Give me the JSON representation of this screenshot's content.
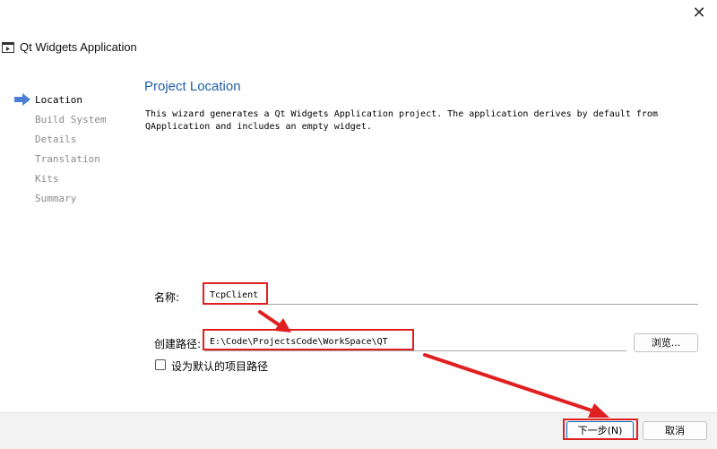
{
  "window": {
    "title": "Qt Widgets Application",
    "close_glyph": "✕"
  },
  "sidebar": {
    "items": [
      {
        "label": "Location",
        "active": true
      },
      {
        "label": "Build System",
        "active": false
      },
      {
        "label": "Details",
        "active": false
      },
      {
        "label": "Translation",
        "active": false
      },
      {
        "label": "Kits",
        "active": false
      },
      {
        "label": "Summary",
        "active": false
      }
    ],
    "active_indicator_icon": "arrow-right-icon",
    "active_indicator_color": "#4a7fd4"
  },
  "main": {
    "title": "Project Location",
    "description_line1": "This wizard generates a Qt Widgets Application project. The application derives by default from",
    "description_line2": "QApplication and includes an empty widget.",
    "name_label": "名称:",
    "name_value": "TcpClient",
    "path_label": "创建路径:",
    "path_value": "E:\\Code\\ProjectsCode\\WorkSpace\\QT",
    "browse_label": "浏览...",
    "default_path_checkbox_label": "设为默认的项目路径",
    "default_path_checked": false
  },
  "footer": {
    "next_label": "下一步(N)",
    "cancel_label": "取消"
  },
  "annotations": {
    "highlight_color": "#e02020",
    "arrow_color": "#e02020"
  }
}
